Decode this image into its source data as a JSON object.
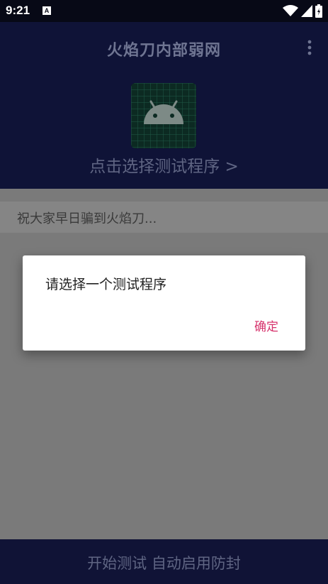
{
  "status_bar": {
    "time": "9:21",
    "notification_badge": "A",
    "icons": [
      "wifi-icon",
      "signal-icon",
      "battery-icon"
    ]
  },
  "app_bar": {
    "title": "火焰刀内部弱网",
    "menu_icon": "more-vert-icon",
    "app_icon": "android-icon",
    "select_prompt": "点击选择测试程序 >"
  },
  "notice": {
    "text": "祝大家早日骗到火焰刀..."
  },
  "bottom_bar": {
    "label": "开始测试 自动启用防封"
  },
  "dialog": {
    "message": "请选择一个测试程序",
    "confirm_label": "确定"
  },
  "colors": {
    "primary_dark": "#0f1337",
    "accent": "#d6336c",
    "scrim": "#7a7a7a",
    "icon_bg": "#0c2a22",
    "android_green": "#3ddc84"
  }
}
